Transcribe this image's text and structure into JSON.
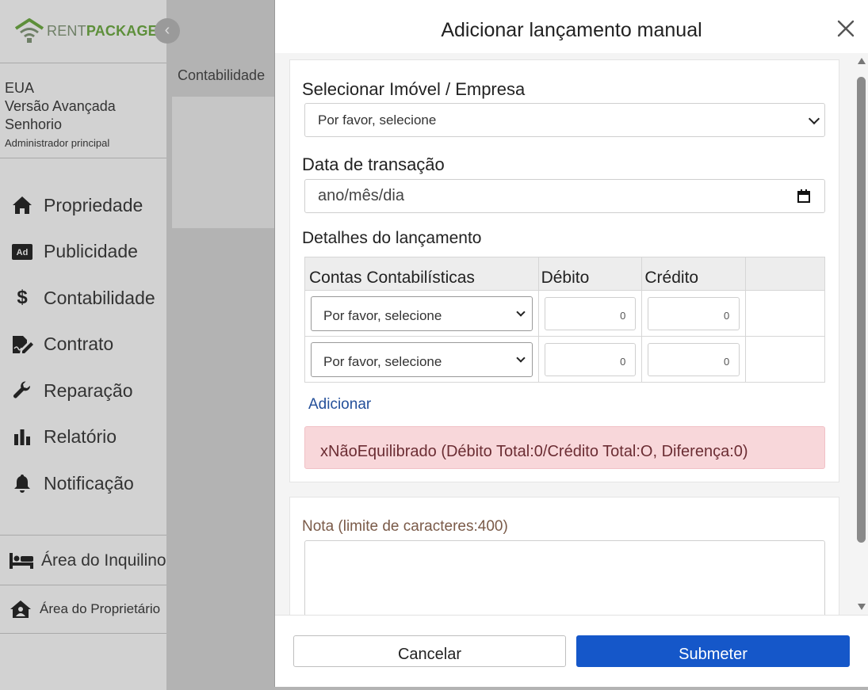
{
  "brand": {
    "part1": "RENT",
    "part2": "PACKAGE"
  },
  "colors": {
    "brand_green": "#5d8f3a",
    "primary": "#1557c9",
    "alert_bg": "#f8d7da",
    "alert_text": "#6b2d33",
    "link": "#24509a"
  },
  "user": {
    "country": "EUA",
    "edition": "Versão Avançada",
    "role": "Senhorio",
    "subrole": "Administrador principal"
  },
  "nav": {
    "items": [
      {
        "label": "Propriedade",
        "icon": "home-icon"
      },
      {
        "label": "Publicidade",
        "icon": "ad-icon"
      },
      {
        "label": "Contabilidade",
        "icon": "dollar-icon"
      },
      {
        "label": "Contrato",
        "icon": "contract-icon"
      },
      {
        "label": "Reparação",
        "icon": "wrench-icon"
      },
      {
        "label": "Relatório",
        "icon": "bar-chart-icon"
      },
      {
        "label": "Notificação",
        "icon": "bell-icon"
      }
    ],
    "tenant_area": "Área do Inquilino",
    "owner_area": "Área do Proprietário"
  },
  "background": {
    "breadcrumb": "Contabilidade"
  },
  "modal": {
    "title": "Adicionar lançamento manual",
    "property_label": "Selecionar Imóvel / Empresa",
    "property_value": "Por favor, selecione",
    "date_label": "Data de transação",
    "date_placeholder": "ano/mês/dia",
    "details_label": "Detalhes do lançamento",
    "table": {
      "headers": [
        "Contas Contabilísticas",
        "Débito",
        "Crédito",
        ""
      ],
      "rows": [
        {
          "account": "Por favor, selecione",
          "debit": "0",
          "credit": "0"
        },
        {
          "account": "Por favor, selecione",
          "debit": "0",
          "credit": "0"
        }
      ]
    },
    "add_link": "Adicionar",
    "alert": "xNãoEquilibrado (Débito Total:0/Crédito Total:O, Diferença:0)",
    "note_label": "Nota (limite de caracteres:400)",
    "cancel_label": "Cancelar",
    "submit_label": "Submeter"
  }
}
